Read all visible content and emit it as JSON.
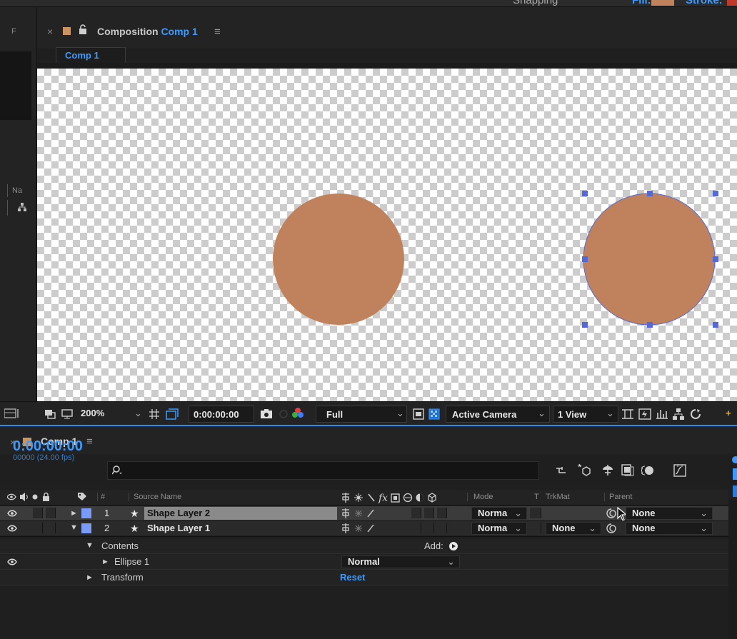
{
  "toolbar": {
    "snapping_label": "Snapping",
    "fill_label": "Fill:",
    "stroke_label": "Stroke:",
    "fill_color": "#c0825c"
  },
  "project": {
    "name_column": "Na"
  },
  "composition_panel": {
    "title_prefix": "Composition",
    "comp_name": "Comp 1",
    "tab_label": "Comp 1"
  },
  "viewer": {
    "shape_color": "#c0825c",
    "selection_color": "#5468d8"
  },
  "viewer_footer": {
    "zoom": "200%",
    "timecode": "0:00:00:00",
    "resolution": "Full",
    "camera": "Active Camera",
    "views": "1 View"
  },
  "timeline": {
    "tab_name": "Comp 1",
    "current_time": "0:00:00:00",
    "frame_info": "00000 (24.00 fps)",
    "columns": {
      "number": "#",
      "source_name": "Source Name",
      "mode": "Mode",
      "t": "T",
      "trkmat": "TrkMat",
      "parent": "Parent"
    },
    "layers": [
      {
        "num": "1",
        "name": "Shape Layer 2",
        "mode": "Norma",
        "trkmat": "",
        "parent": "None",
        "color": "#7a9cf8"
      },
      {
        "num": "2",
        "name": "Shape Layer 1",
        "mode": "Norma",
        "trkmat": "None",
        "parent": "None",
        "color": "#7a9cf8"
      }
    ],
    "contents_label": "Contents",
    "add_label": "Add:",
    "ellipse_label": "Ellipse 1",
    "ellipse_blend": "Normal",
    "transform_label": "Transform",
    "reset_label": "Reset"
  }
}
